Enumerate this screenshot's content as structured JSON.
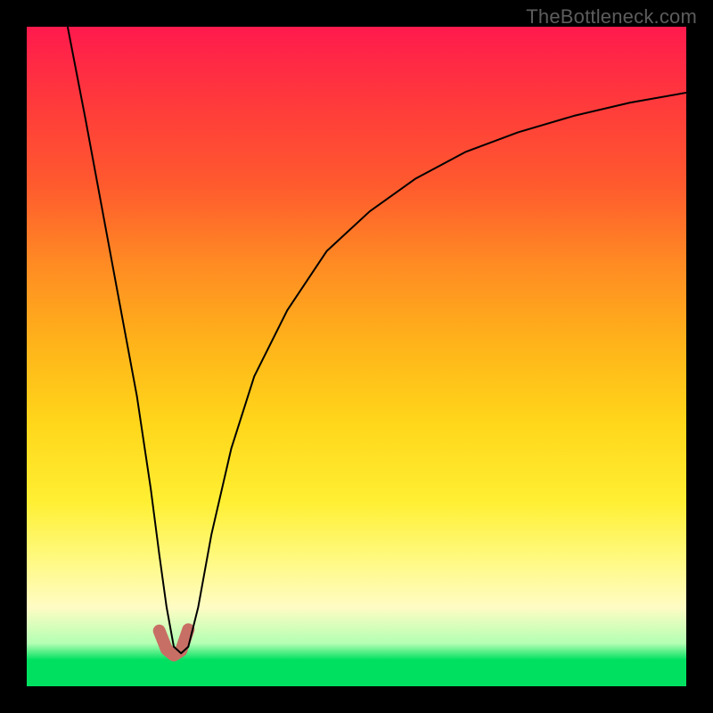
{
  "watermark": {
    "text": "TheBottleneck.com"
  },
  "colors": {
    "frame": "#000000",
    "curve": "#000000",
    "accent": "#c86f65",
    "gradient_stops": [
      {
        "pos": 0.0,
        "color": "#ff1a4d"
      },
      {
        "pos": 0.12,
        "color": "#ff3b3b"
      },
      {
        "pos": 0.24,
        "color": "#ff5a2e"
      },
      {
        "pos": 0.36,
        "color": "#ff8b23"
      },
      {
        "pos": 0.48,
        "color": "#ffb31a"
      },
      {
        "pos": 0.6,
        "color": "#ffd61a"
      },
      {
        "pos": 0.72,
        "color": "#ffef33"
      },
      {
        "pos": 0.8,
        "color": "#fff97a"
      },
      {
        "pos": 0.88,
        "color": "#fffcc4"
      },
      {
        "pos": 0.935,
        "color": "#b3ffb3"
      },
      {
        "pos": 0.96,
        "color": "#00e060"
      },
      {
        "pos": 1.0,
        "color": "#00e060"
      }
    ]
  },
  "chart_data": {
    "type": "line",
    "title": "",
    "xlabel": "",
    "ylabel": "",
    "xlim": [
      0,
      1
    ],
    "ylim": [
      0,
      1
    ],
    "note": "V-shaped bottleneck curve; minimum near x≈0.22; secondary (accent) short U-shaped segment highlighted at the trough. Values are proportional (0..1 in each axis) read off pixel positions; no axis ticks or numeric labels are rendered in the image.",
    "series": [
      {
        "name": "main-curve",
        "x": [
          0.062,
          0.089,
          0.115,
          0.141,
          0.167,
          0.188,
          0.201,
          0.212,
          0.223,
          0.234,
          0.245,
          0.26,
          0.28,
          0.31,
          0.345,
          0.395,
          0.455,
          0.52,
          0.59,
          0.665,
          0.745,
          0.83,
          0.915,
          1.0
        ],
        "y": [
          1.0,
          0.86,
          0.72,
          0.58,
          0.44,
          0.3,
          0.2,
          0.12,
          0.06,
          0.05,
          0.06,
          0.12,
          0.23,
          0.36,
          0.47,
          0.57,
          0.66,
          0.72,
          0.77,
          0.81,
          0.84,
          0.865,
          0.885,
          0.9
        ]
      },
      {
        "name": "accent-trough",
        "x": [
          0.201,
          0.212,
          0.223,
          0.234,
          0.245
        ],
        "y": [
          0.084,
          0.056,
          0.047,
          0.054,
          0.086
        ]
      }
    ]
  }
}
